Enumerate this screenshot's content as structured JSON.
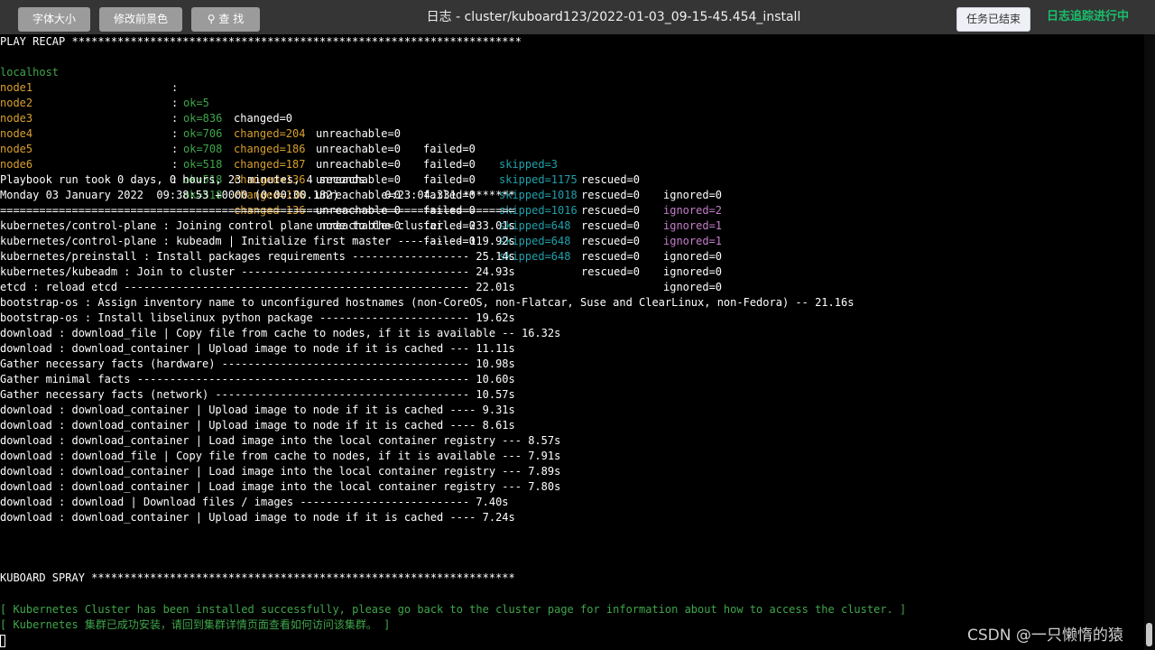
{
  "toolbar": {
    "font_size_label": "字体大小",
    "fg_color_label": "修改前景色",
    "search_label": "查 找",
    "title": "日志 - cluster/kuboard123/2022-01-03_09-15-45.454_install",
    "task_ended_label": "任务已结束",
    "tracing_label": "日志追踪进行中"
  },
  "colors": {
    "green": "#3fa64a",
    "orange": "#d8a02d",
    "cyan": "#21a0ab",
    "magenta": "#c47ecb",
    "tracing": "#19be6b"
  },
  "terminal": {
    "play_recap": "PLAY RECAP *********************************************************************",
    "recap": [
      {
        "host": "localhost",
        "ok": "ok=5",
        "changed": "changed=0",
        "unreachable": "unreachable=0",
        "failed": "failed=0",
        "skipped": "skipped=3",
        "rescued": "rescued=0",
        "ignored": "ignored=0"
      },
      {
        "host": "node1",
        "ok": "ok=836",
        "changed": "changed=204",
        "unreachable": "unreachable=0",
        "failed": "failed=0",
        "skipped": "skipped=1175",
        "rescued": "rescued=0",
        "ignored": "ignored=2"
      },
      {
        "host": "node2",
        "ok": "ok=706",
        "changed": "changed=186",
        "unreachable": "unreachable=0",
        "failed": "failed=0",
        "skipped": "skipped=1018",
        "rescued": "rescued=0",
        "ignored": "ignored=1"
      },
      {
        "host": "node3",
        "ok": "ok=708",
        "changed": "changed=187",
        "unreachable": "unreachable=0",
        "failed": "failed=0",
        "skipped": "skipped=1016",
        "rescued": "rescued=0",
        "ignored": "ignored=1"
      },
      {
        "host": "node4",
        "ok": "ok=518",
        "changed": "changed=136",
        "unreachable": "unreachable=0",
        "failed": "failed=0",
        "skipped": "skipped=648",
        "rescued": "rescued=0",
        "ignored": "ignored=0"
      },
      {
        "host": "node5",
        "ok": "ok=518",
        "changed": "changed=136",
        "unreachable": "unreachable=0",
        "failed": "failed=0",
        "skipped": "skipped=648",
        "rescued": "rescued=0",
        "ignored": "ignored=0"
      },
      {
        "host": "node6",
        "ok": "ok=518",
        "changed": "changed=136",
        "unreachable": "unreachable=0",
        "failed": "failed=0",
        "skipped": "skipped=648",
        "rescued": "rescued=0",
        "ignored": "ignored=0"
      }
    ],
    "playbook_took": "Playbook run took 0 days, 0 hours, 23 minutes, 4 seconds",
    "monday_line": "Monday 03 January 2022  09:38:53 +0000 (0:00:00.182)       0:23:04.331 ********",
    "separator": "===============================================================================",
    "timings": [
      "kubernetes/control-plane : Joining control plane node to the cluster. - 233.01s",
      "kubernetes/control-plane : kubeadm | Initialize first master ---------- 119.92s",
      "kubernetes/preinstall : Install packages requirements ------------------ 25.14s",
      "kubernetes/kubeadm : Join to cluster ----------------------------------- 24.93s",
      "etcd : reload etcd ----------------------------------------------------- 22.01s",
      "bootstrap-os : Assign inventory name to unconfigured hostnames (non-CoreOS, non-Flatcar, Suse and ClearLinux, non-Fedora) -- 21.16s",
      "bootstrap-os : Install libselinux python package ----------------------- 19.62s",
      "download : download_file | Copy file from cache to nodes, if it is available -- 16.32s",
      "download : download_container | Upload image to node if it is cached --- 11.11s",
      "Gather necessary facts (hardware) -------------------------------------- 10.98s",
      "Gather minimal facts --------------------------------------------------- 10.60s",
      "Gather necessary facts (network) --------------------------------------- 10.57s",
      "download : download_container | Upload image to node if it is cached ---- 9.31s",
      "download : download_container | Upload image to node if it is cached ---- 8.61s",
      "download : download_container | Load image into the local container registry --- 8.57s",
      "download : download_file | Copy file from cache to nodes, if it is available --- 7.91s",
      "download : download_container | Load image into the local container registry --- 7.89s",
      "download : download_container | Load image into the local container registry --- 7.80s",
      "download : download | Download files / images -------------------------- 7.40s",
      "download : download_container | Upload image to node if it is cached ---- 7.24s"
    ],
    "kuboard_spray": "KUBOARD SPRAY *****************************************************************",
    "success_en": "[ Kubernetes Cluster has been installed successfully, please go back to the cluster page for information about how to access the cluster. ]",
    "success_zh": "[ Kubernetes 集群已成功安装，请回到集群详情页面查看如何访问该集群。 ]"
  },
  "watermark": "CSDN @一只懒惰的猿"
}
